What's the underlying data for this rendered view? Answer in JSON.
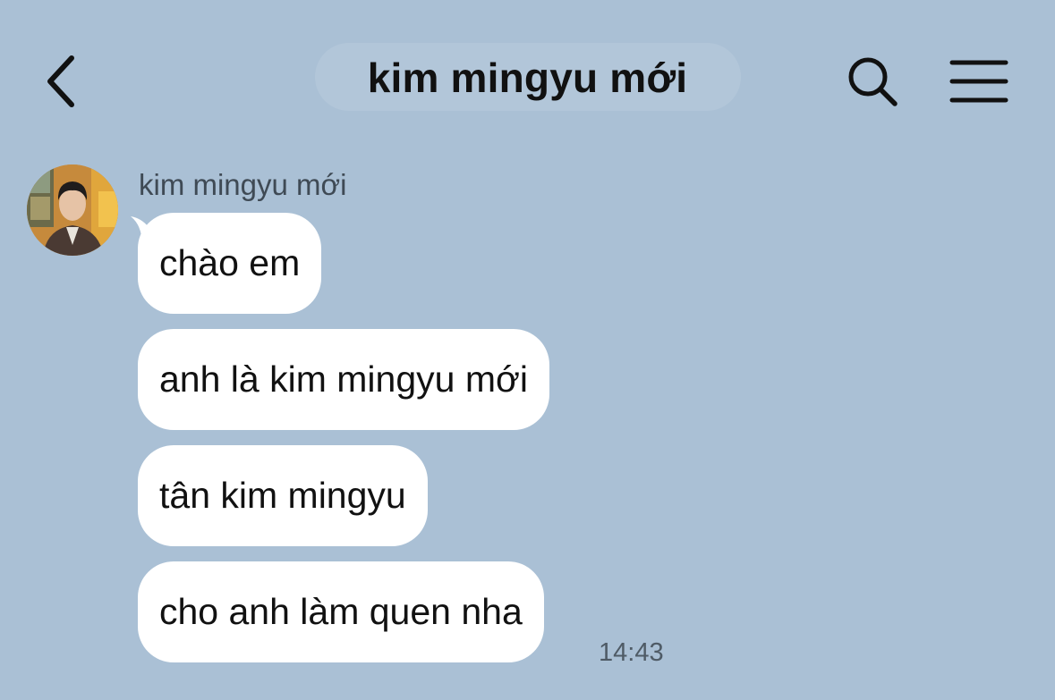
{
  "header": {
    "title": "kim mingyu mới",
    "back_icon": "chevron-left-icon",
    "search_icon": "search-icon",
    "menu_icon": "hamburger-menu-icon"
  },
  "conversation": {
    "sender_name": "kim mingyu mới",
    "messages": [
      {
        "text": "chào em"
      },
      {
        "text": "anh là kim mingyu mới"
      },
      {
        "text": "tân kim mingyu"
      },
      {
        "text": "cho anh làm quen nha"
      }
    ],
    "last_timestamp": "14:43"
  },
  "colors": {
    "background": "#aac0d5",
    "bubble": "#ffffff",
    "text": "#111111"
  }
}
